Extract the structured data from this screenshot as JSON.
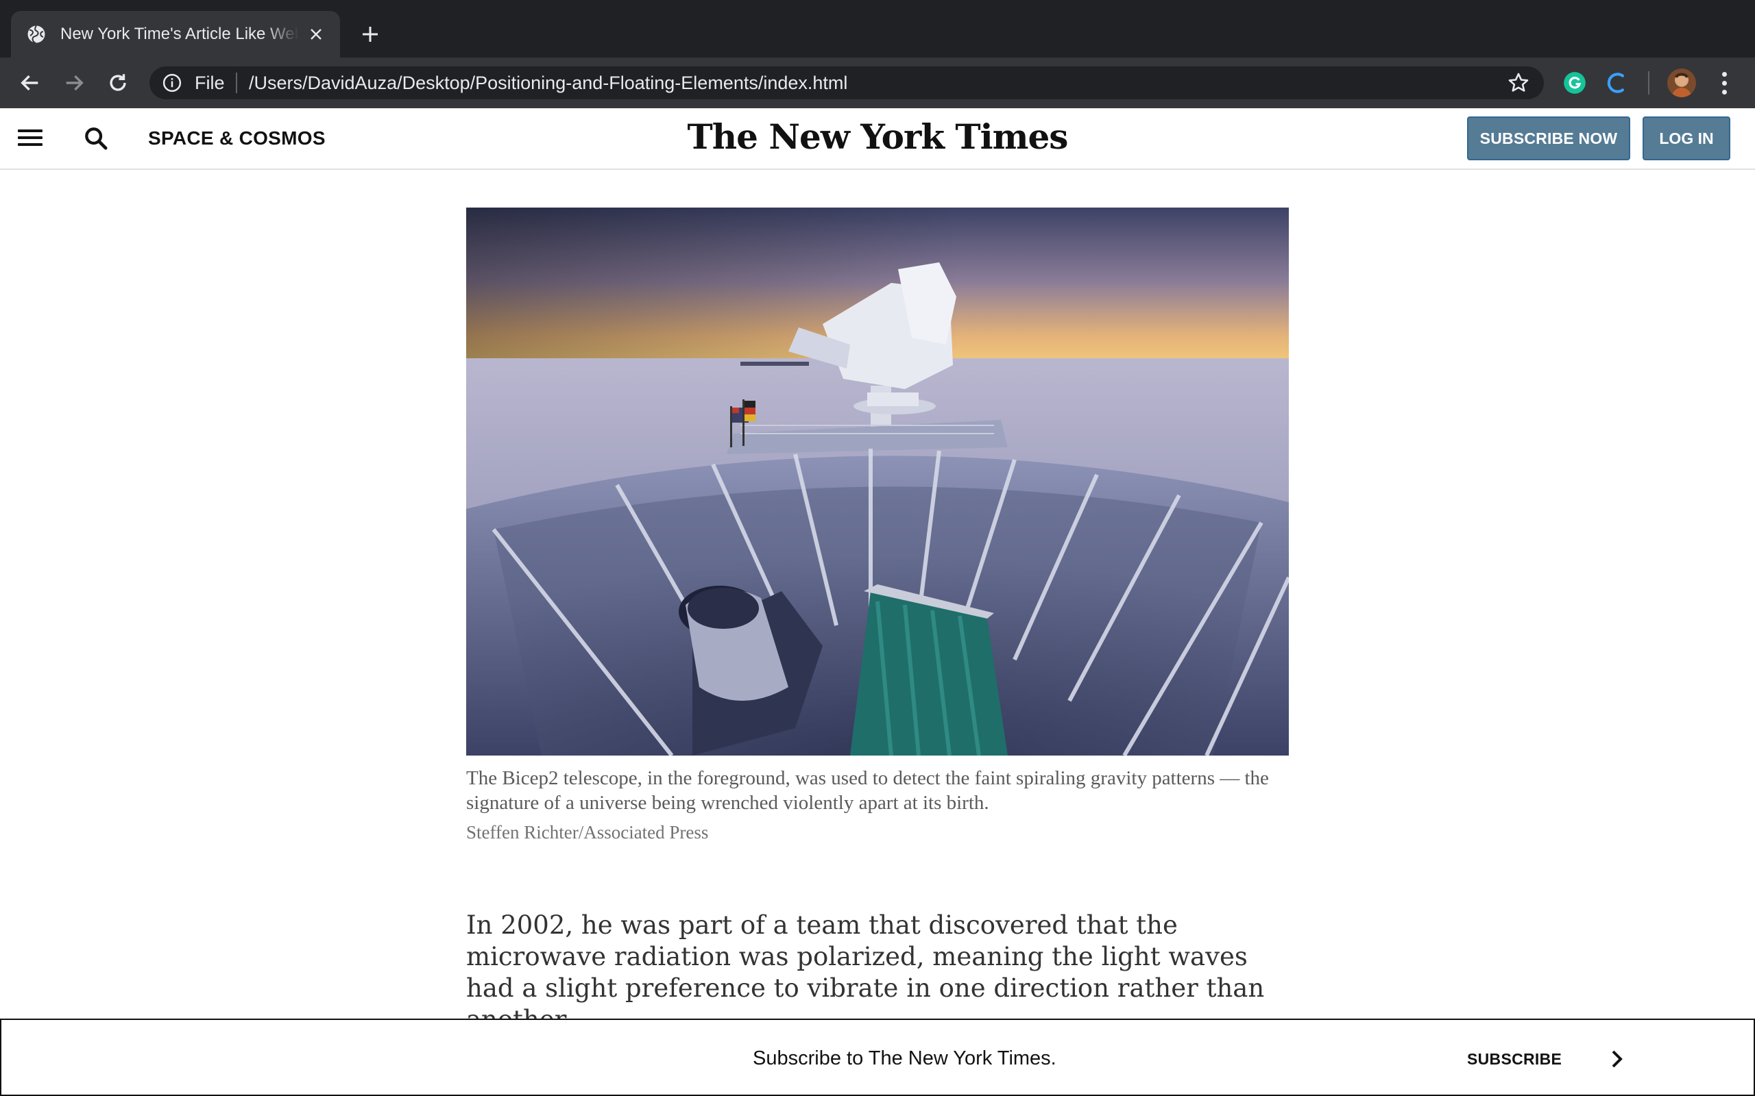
{
  "browser": {
    "tab": {
      "title": "New York Time's Article Like Web Page",
      "favicon": "globe-icon"
    },
    "omnibox": {
      "scheme_label": "File",
      "url": "/Users/DavidAuza/Desktop/Positioning-and-Floating-Elements/index.html"
    },
    "extensions": [
      "grammarly-icon",
      "loading-spinner-icon"
    ],
    "colors": {
      "tabstrip": "#202124",
      "toolbar": "#35363a",
      "text": "#e8eaed"
    }
  },
  "header": {
    "section_name": "SPACE & COSMOS",
    "masthead": "The New York Times",
    "subscribe_label": "SUBSCRIBE NOW",
    "login_label": "LOG IN",
    "button_color": "#567b95"
  },
  "article": {
    "image_alt": "The Bicep2 telescope at the South Pole at dusk",
    "caption": "The Bicep2 telescope, in the foreground, was used to detect the faint spiraling gravity patterns — the signature of a universe being wrenched violently apart at its birth.",
    "credit": "Steffen Richter/Associated Press",
    "paragraph": "In 2002, he was part of a team that discovered that the microwave radiation was polarized, meaning the light waves had a slight preference to vibrate in one direction rather than another."
  },
  "subscribe_bar": {
    "text": "Subscribe to The New York Times.",
    "link_label": "SUBSCRIBE"
  }
}
